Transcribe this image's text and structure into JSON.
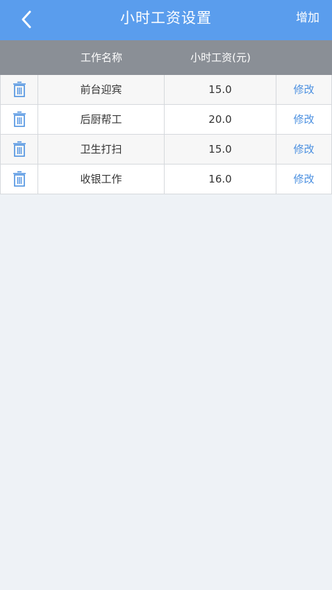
{
  "nav": {
    "title": "小时工资设置",
    "add_label": "增加",
    "back_icon": "chevron-left-icon"
  },
  "table": {
    "headers": [
      "工作名称",
      "小时工资(元)"
    ],
    "rows": [
      {
        "name": "前台迎宾",
        "wage": "15.0",
        "edit_label": "修改",
        "delete_icon": "trash-icon"
      },
      {
        "name": "后厨帮工",
        "wage": "20.0",
        "edit_label": "修改",
        "delete_icon": "trash-icon"
      },
      {
        "name": "卫生打扫",
        "wage": "15.0",
        "edit_label": "修改",
        "delete_icon": "trash-icon"
      },
      {
        "name": "收银工作",
        "wage": "16.0",
        "edit_label": "修改",
        "delete_icon": "trash-icon"
      }
    ]
  },
  "colors": {
    "nav_bg": "#5a9ded",
    "header_bg": "#8a8f96",
    "page_bg": "#eef2f6",
    "accent": "#4a8fe0"
  }
}
